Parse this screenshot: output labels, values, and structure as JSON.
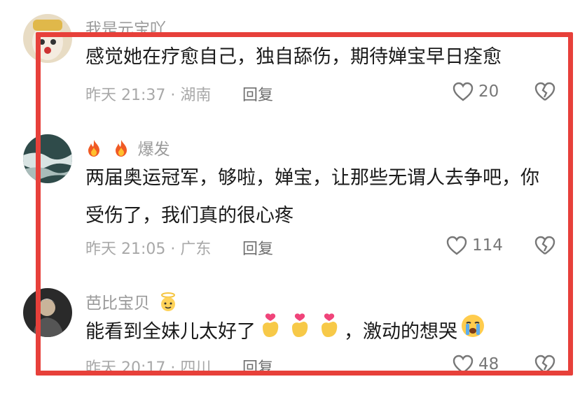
{
  "colors": {
    "highlight_border": "#e7403a",
    "meta_text": "#a8a8a8",
    "body_text": "#1a1a1a"
  },
  "comments": [
    {
      "username": "我是元宝吖",
      "text": "感觉她在疗愈自己，独自舔伤，期待婵宝早日痊愈",
      "meta": "昨天 21:37 · 湖南",
      "reply": "回复",
      "likes": "20"
    },
    {
      "username": "爆发",
      "username_prefix_icons": [
        "fire-icon",
        "fire-icon"
      ],
      "text": "两届奥运冠军，够啦，婵宝，让那些无谓人去争吧，你受伤了，我们真的很心疼",
      "meta": "昨天 21:05 · 广东",
      "reply": "回复",
      "likes": "114"
    },
    {
      "username": "芭比宝贝",
      "username_suffix_icon": "angel-emoji-icon",
      "text_before_emoji": "能看到全妹儿太好了",
      "inline_emojis": [
        "finger-heart-icon",
        "finger-heart-icon",
        "finger-heart-icon"
      ],
      "text_after_emoji": "，激动的想哭",
      "trailing_emoji": "crying-face-icon",
      "meta": "昨天 20:17 · 四川",
      "reply": "回复",
      "likes": "48"
    }
  ]
}
